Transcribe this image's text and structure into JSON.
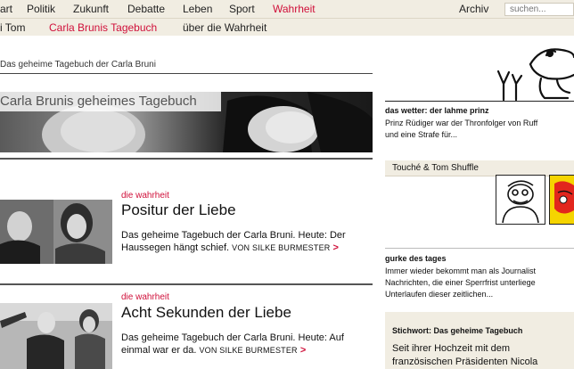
{
  "topnav": {
    "items": [
      "art",
      "Politik",
      "Zukunft",
      "Debatte",
      "Leben",
      "Sport",
      "Wahrheit"
    ],
    "active_index": 6,
    "archive": "Archiv",
    "search_placeholder": "suchen..."
  },
  "subnav": {
    "items": [
      "i Tom",
      "Carla Brunis Tagebuch",
      "über die Wahrheit"
    ],
    "active_index": 1
  },
  "breadcrumb": "Das geheime Tagebuch der Carla Bruni",
  "hero": {
    "caption": "Carla Brunis geheimes Tagebuch"
  },
  "articles": [
    {
      "kicker": "die wahrheit",
      "headline": "Positur der Liebe",
      "teaser": "Das geheime Tagebuch der Carla Bruni. Heute: Der Haussegen hängt schief.",
      "author": "VON SILKE BURMESTER",
      "arrow": ">"
    },
    {
      "kicker": "die wahrheit",
      "headline": "Acht Sekunden der Liebe",
      "teaser": "Das geheime Tagebuch der Carla Bruni. Heute: Auf einmal war er da.",
      "author": "VON SILKE BURMESTER",
      "arrow": ">"
    }
  ],
  "sidebar": {
    "wetter": {
      "title": "das wetter: der lahme prinz",
      "line1": "Prinz Rüdiger war der Thronfolger von Ruff",
      "line2": "und eine Strafe für..."
    },
    "touche": {
      "title": "Touché & Tom Shuffle"
    },
    "gurke": {
      "title": "gurke des tages",
      "line1": "Immer wieder bekommt man als Journalist",
      "line2": "Nachrichten, die einer Sperrfrist unterliege",
      "line3": "Unterlaufen dieser zeitlichen..."
    },
    "stichwort": {
      "title": "Stichwort: Das geheime Tagebuch",
      "line1": "Seit ihrer Hochzeit mit dem",
      "line2": "französischen Präsidenten Nicola"
    }
  },
  "colors": {
    "accent": "#d0103a",
    "nav_bg": "#f1ede2"
  }
}
